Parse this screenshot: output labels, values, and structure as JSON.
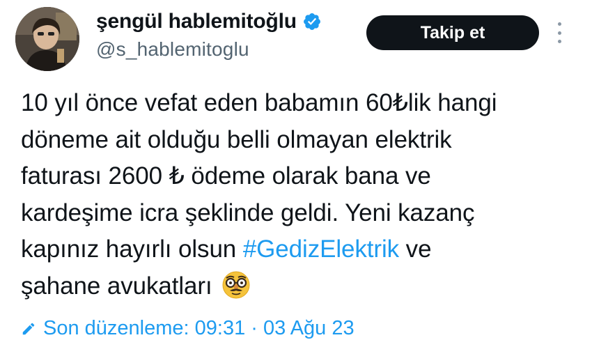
{
  "user": {
    "display_name": "şengül hablemitoğlu",
    "handle": "@s_hablemitoglu",
    "verified": true
  },
  "follow_button": {
    "label": "Takip et"
  },
  "more_menu": {
    "icon": "more-vertical-icon"
  },
  "tweet": {
    "lines": [
      "10 yıl önce vefat eden babamın 60₺lik hangi",
      "döneme ait olduğu belli olmayan elektrik",
      "faturası 2600 ₺ ödeme olarak bana ve",
      "kardeşime icra şeklinde geldi. Yeni kazanç"
    ],
    "line5_prefix": "kapınız hayırlı olsun ",
    "hashtag": "#GedizElektrik",
    "line5_suffix": " ve",
    "line6": "şahane avukatları",
    "emoji": "disguised-face-emoji"
  },
  "edited": {
    "text": "Son düzenleme: 09:31 · 03 Ağu 23"
  },
  "colors": {
    "accent": "#1d9bf0",
    "text": "#0f1419",
    "muted": "#536471",
    "button_bg": "#0f1419"
  }
}
